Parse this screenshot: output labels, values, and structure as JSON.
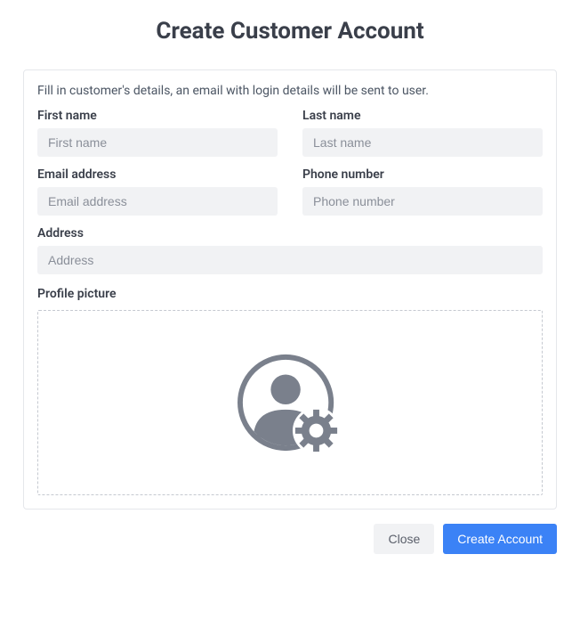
{
  "header": {
    "title": "Create Customer Account"
  },
  "form": {
    "description": "Fill in customer's details, an email with login details will be sent to user.",
    "first_name": {
      "label": "First name",
      "placeholder": "First name",
      "value": ""
    },
    "last_name": {
      "label": "Last name",
      "placeholder": "Last name",
      "value": ""
    },
    "email": {
      "label": "Email address",
      "placeholder": "Email address",
      "value": ""
    },
    "phone": {
      "label": "Phone number",
      "placeholder": "Phone number",
      "value": ""
    },
    "address": {
      "label": "Address",
      "placeholder": "Address",
      "value": ""
    },
    "profile_picture": {
      "label": "Profile picture"
    }
  },
  "footer": {
    "close_label": "Close",
    "create_label": "Create Account"
  }
}
